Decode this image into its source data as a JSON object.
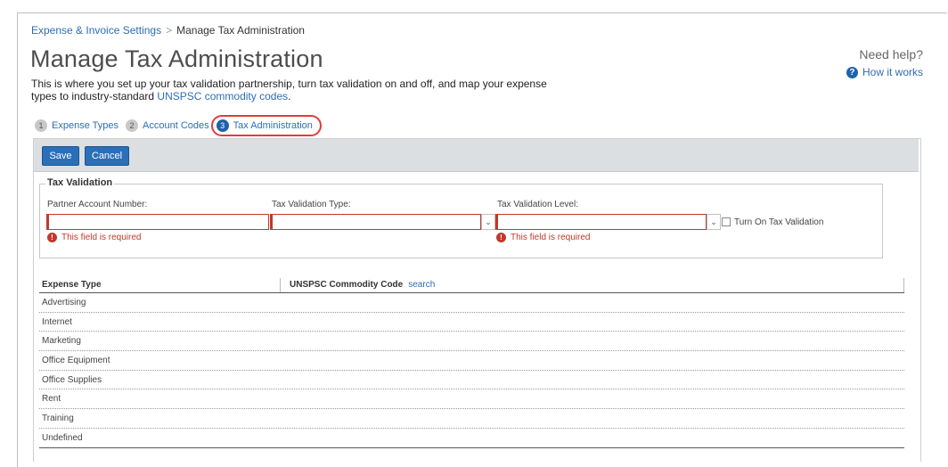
{
  "breadcrumb": {
    "parent": "Expense & Invoice Settings",
    "separator": ">",
    "current": "Manage Tax Administration"
  },
  "page": {
    "title": "Manage Tax Administration",
    "description_part1": "This is where you set up your tax validation partnership, turn tax validation on and off, and map your expense types to industry-standard ",
    "description_link": "UNSPSC commodity codes",
    "description_end": "."
  },
  "help": {
    "title": "Need help?",
    "link": "How it works",
    "icon": "question-circle-icon"
  },
  "steps": [
    {
      "num": "1",
      "label": "Expense Types"
    },
    {
      "num": "2",
      "label": "Account Codes"
    },
    {
      "num": "3",
      "label": "Tax Administration"
    }
  ],
  "toolbar": {
    "save_label": "Save",
    "cancel_label": "Cancel"
  },
  "tax_validation": {
    "legend": "Tax Validation",
    "partner_account_label": "Partner Account Number:",
    "partner_account_value": "",
    "validation_type_label": "Tax Validation Type:",
    "validation_type_value": "",
    "validation_level_label": "Tax Validation Level:",
    "validation_level_value": "",
    "turn_on_label": "Turn On Tax Validation",
    "turn_on_checked": false,
    "error_message": "This field is required"
  },
  "table": {
    "col1_header": "Expense Type",
    "col2_header": "UNSPSC Commodity Code",
    "col2_link": "search",
    "rows": [
      "Advertising",
      "Internet",
      "Marketing",
      "Office Equipment",
      "Office Supplies",
      "Rent",
      "Training",
      "Undefined"
    ]
  },
  "colors": {
    "link": "#2d6db5",
    "primary_button": "#2a6fb8",
    "error": "#c0392b",
    "highlight_ring": "#e03c3c"
  }
}
